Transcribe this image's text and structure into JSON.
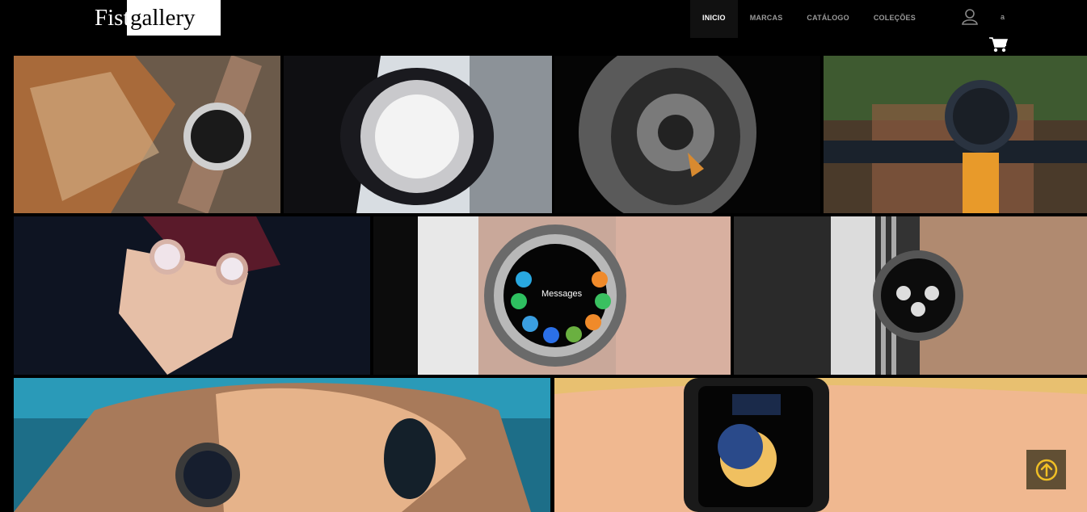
{
  "brand": {
    "logo_left": "Fist",
    "logo_right": "gallery"
  },
  "nav": {
    "items": [
      {
        "label": "INICIO",
        "active": true
      },
      {
        "label": "MARCAS",
        "active": false
      },
      {
        "label": "CATÁLOGO",
        "active": false
      },
      {
        "label": "COLEÇÕES",
        "active": false
      }
    ]
  },
  "account": {
    "user_label": "a"
  },
  "icons": {
    "user": "user-icon",
    "cart": "shopping-cart-icon",
    "scroll_top": "arrow-up-circle-icon"
  },
  "gallery": {
    "photo_6_screen_text": "Messages"
  },
  "colors": {
    "accent": "#f0c020",
    "navbar_bg": "#000000",
    "active_nav_bg": "#111111"
  }
}
